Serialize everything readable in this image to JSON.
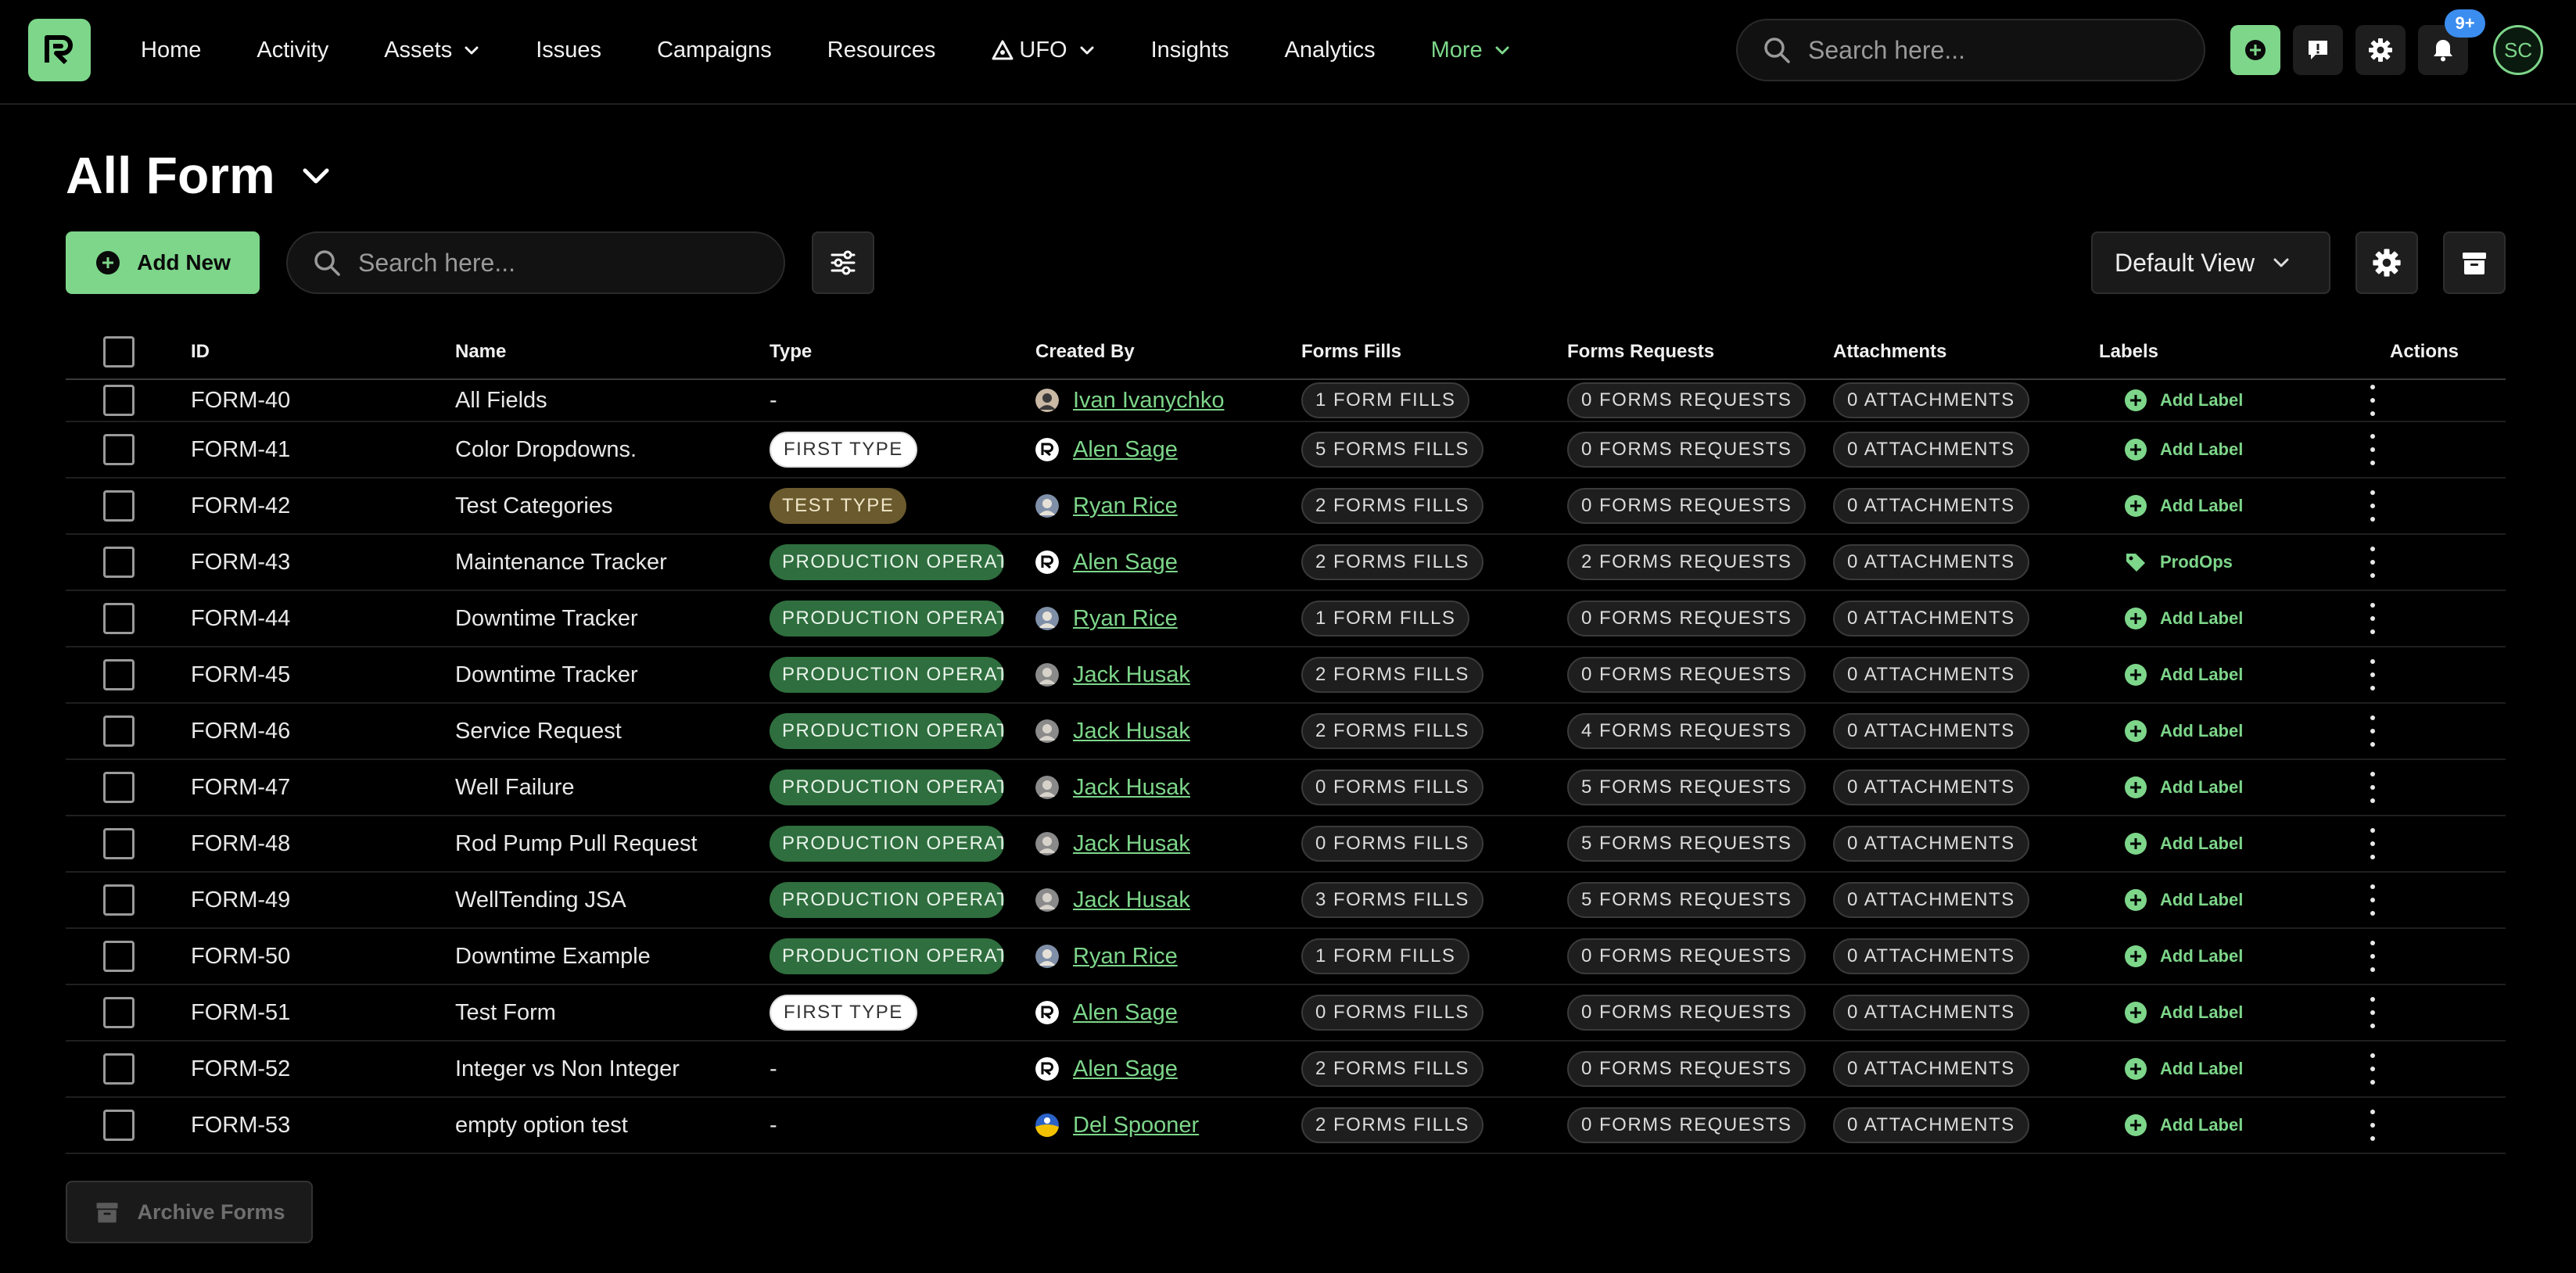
{
  "nav": {
    "items": [
      {
        "label": "Home",
        "name": "nav-home",
        "chevron": false,
        "active": false
      },
      {
        "label": "Activity",
        "name": "nav-activity",
        "chevron": false,
        "active": false
      },
      {
        "label": "Assets",
        "name": "nav-assets",
        "chevron": true,
        "active": false
      },
      {
        "label": "Issues",
        "name": "nav-issues",
        "chevron": false,
        "active": false
      },
      {
        "label": "Campaigns",
        "name": "nav-campaigns",
        "chevron": false,
        "active": false
      },
      {
        "label": "Resources",
        "name": "nav-resources",
        "chevron": false,
        "active": false
      },
      {
        "label": "UFO",
        "name": "nav-ufo",
        "chevron": true,
        "active": false,
        "icon": "ufo-triangle-icon"
      },
      {
        "label": "Insights",
        "name": "nav-insights",
        "chevron": false,
        "active": false
      },
      {
        "label": "Analytics",
        "name": "nav-analytics",
        "chevron": false,
        "active": false
      },
      {
        "label": "More",
        "name": "nav-more",
        "chevron": true,
        "active": true
      }
    ],
    "search_placeholder": "Search here...",
    "notification_count": "9+",
    "user_initials": "SC"
  },
  "page": {
    "title": "All Form",
    "add_new_label": "Add New",
    "search_placeholder": "Search here...",
    "view_label": "Default View",
    "archive_label": "Archive Forms"
  },
  "colors": {
    "accent": "#7dd68a",
    "prod_pill": "#2f6e3e",
    "test_pill": "#6a5a2e",
    "badge": "#3b8df0"
  },
  "table": {
    "headers": {
      "id": "ID",
      "name": "Name",
      "type": "Type",
      "created_by": "Created By",
      "fills": "Forms Fills",
      "requests": "Forms Requests",
      "attachments": "Attachments",
      "labels": "Labels",
      "actions": "Actions"
    },
    "rows": [
      {
        "id": "FORM-40",
        "name": "All Fields",
        "type": "-",
        "type_kind": "none",
        "creator": "Ivan Ivanychko",
        "avatar": "photo-a",
        "fills": "1 FORM FILLS",
        "requests": "0 FORMS REQUESTS",
        "attachments": "0 ATTACHMENTS",
        "label": "Add Label",
        "label_kind": "add"
      },
      {
        "id": "FORM-41",
        "name": "Color Dropdowns.",
        "type": "FIRST TYPE",
        "type_kind": "first",
        "creator": "Alen Sage",
        "avatar": "logo",
        "fills": "5 FORMS FILLS",
        "requests": "0 FORMS REQUESTS",
        "attachments": "0 ATTACHMENTS",
        "label": "Add Label",
        "label_kind": "add"
      },
      {
        "id": "FORM-42",
        "name": "Test Categories",
        "type": "TEST TYPE",
        "type_kind": "test",
        "creator": "Ryan Rice",
        "avatar": "photo-b",
        "fills": "2 FORMS FILLS",
        "requests": "0 FORMS REQUESTS",
        "attachments": "0 ATTACHMENTS",
        "label": "Add Label",
        "label_kind": "add"
      },
      {
        "id": "FORM-43",
        "name": "Maintenance Tracker",
        "type": "PRODUCTION OPERATIONS",
        "type_kind": "prod",
        "creator": "Alen Sage",
        "avatar": "logo",
        "fills": "2 FORMS FILLS",
        "requests": "2 FORMS REQUESTS",
        "attachments": "0 ATTACHMENTS",
        "label": "ProdOps",
        "label_kind": "tag"
      },
      {
        "id": "FORM-44",
        "name": "Downtime Tracker",
        "type": "PRODUCTION OPERATIONS",
        "type_kind": "prod",
        "creator": "Ryan Rice",
        "avatar": "photo-b",
        "fills": "1 FORM FILLS",
        "requests": "0 FORMS REQUESTS",
        "attachments": "0 ATTACHMENTS",
        "label": "Add Label",
        "label_kind": "add"
      },
      {
        "id": "FORM-45",
        "name": "Downtime Tracker",
        "type": "PRODUCTION OPERATIONS",
        "type_kind": "prod",
        "creator": "Jack Husak",
        "avatar": "photo-c",
        "fills": "2 FORMS FILLS",
        "requests": "0 FORMS REQUESTS",
        "attachments": "0 ATTACHMENTS",
        "label": "Add Label",
        "label_kind": "add"
      },
      {
        "id": "FORM-46",
        "name": "Service Request",
        "type": "PRODUCTION OPERATIONS",
        "type_kind": "prod",
        "creator": "Jack Husak",
        "avatar": "photo-c",
        "fills": "2 FORMS FILLS",
        "requests": "4 FORMS REQUESTS",
        "attachments": "0 ATTACHMENTS",
        "label": "Add Label",
        "label_kind": "add"
      },
      {
        "id": "FORM-47",
        "name": "Well Failure",
        "type": "PRODUCTION OPERATIONS",
        "type_kind": "prod",
        "creator": "Jack Husak",
        "avatar": "photo-c",
        "fills": "0 FORMS FILLS",
        "requests": "5 FORMS REQUESTS",
        "attachments": "0 ATTACHMENTS",
        "label": "Add Label",
        "label_kind": "add"
      },
      {
        "id": "FORM-48",
        "name": "Rod Pump Pull Request",
        "type": "PRODUCTION OPERATIONS",
        "type_kind": "prod",
        "creator": "Jack Husak",
        "avatar": "photo-c",
        "fills": "0 FORMS FILLS",
        "requests": "5 FORMS REQUESTS",
        "attachments": "0 ATTACHMENTS",
        "label": "Add Label",
        "label_kind": "add"
      },
      {
        "id": "FORM-49",
        "name": "WellTending JSA",
        "type": "PRODUCTION OPERATIONS",
        "type_kind": "prod",
        "creator": "Jack Husak",
        "avatar": "photo-c",
        "fills": "3 FORMS FILLS",
        "requests": "5 FORMS REQUESTS",
        "attachments": "0 ATTACHMENTS",
        "label": "Add Label",
        "label_kind": "add"
      },
      {
        "id": "FORM-50",
        "name": "Downtime Example",
        "type": "PRODUCTION OPERATIONS",
        "type_kind": "prod",
        "creator": "Ryan Rice",
        "avatar": "photo-b",
        "fills": "1 FORM FILLS",
        "requests": "0 FORMS REQUESTS",
        "attachments": "0 ATTACHMENTS",
        "label": "Add Label",
        "label_kind": "add"
      },
      {
        "id": "FORM-51",
        "name": "Test Form",
        "type": "FIRST TYPE",
        "type_kind": "first",
        "creator": "Alen Sage",
        "avatar": "logo",
        "fills": "0 FORMS FILLS",
        "requests": "0 FORMS REQUESTS",
        "attachments": "0 ATTACHMENTS",
        "label": "Add Label",
        "label_kind": "add"
      },
      {
        "id": "FORM-52",
        "name": "Integer vs Non Integer",
        "type": "-",
        "type_kind": "none",
        "creator": "Alen Sage",
        "avatar": "logo",
        "fills": "2 FORMS FILLS",
        "requests": "0 FORMS REQUESTS",
        "attachments": "0 ATTACHMENTS",
        "label": "Add Label",
        "label_kind": "add"
      },
      {
        "id": "FORM-53",
        "name": "empty option test",
        "type": "-",
        "type_kind": "none",
        "creator": "Del Spooner",
        "avatar": "globe",
        "fills": "2 FORMS FILLS",
        "requests": "0 FORMS REQUESTS",
        "attachments": "0 ATTACHMENTS",
        "label": "Add Label",
        "label_kind": "add"
      }
    ]
  }
}
